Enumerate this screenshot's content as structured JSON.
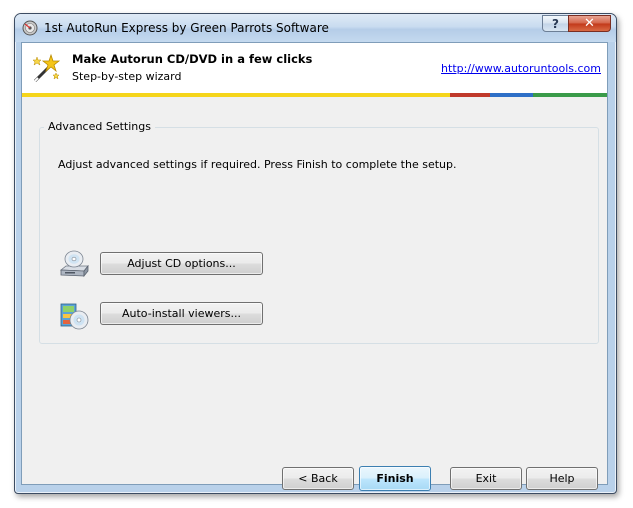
{
  "window": {
    "title": "1st AutoRun Express by Green Parrots Software",
    "help_label": "?",
    "close_label": "✕"
  },
  "header": {
    "title": "Make Autorun CD/DVD in a few clicks",
    "subtitle": "Step-by-step wizard",
    "link": "http://www.autoruntools.com",
    "strip_colors": [
      "#f5d51b",
      "#c0392b",
      "#2e6fc7",
      "#3a9b49"
    ]
  },
  "advanced": {
    "legend": "Advanced Settings",
    "description": "Adjust advanced settings if required. Press Finish to complete the setup.",
    "cd_options_label": "Adjust CD options...",
    "viewers_label": "Auto-install viewers..."
  },
  "footer": {
    "back_label": "< Back",
    "finish_label": "Finish",
    "exit_label": "Exit",
    "help_label": "Help"
  },
  "icons": {
    "app": "app-icon",
    "header": "magic-wand-icon",
    "cd_options": "cd-drive-icon",
    "viewers": "installer-box-icon"
  }
}
